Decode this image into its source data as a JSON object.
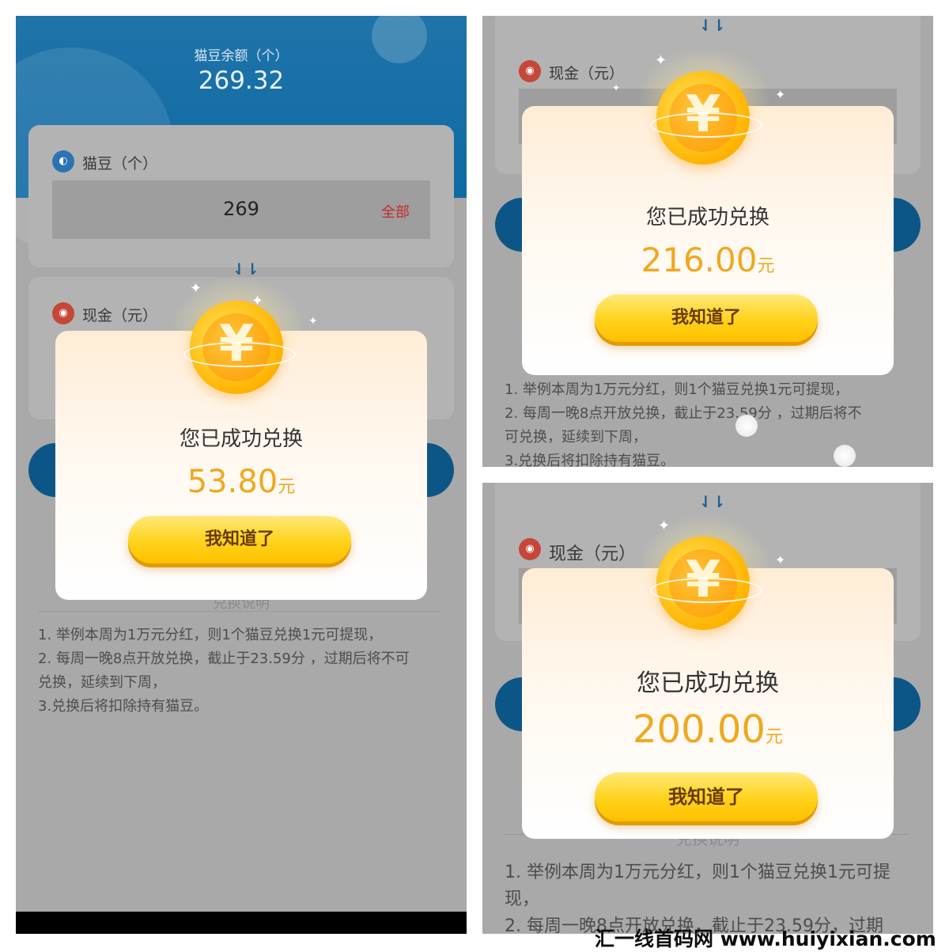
{
  "panel1": {
    "balance_label": "猫豆余额（个）",
    "balance_value": "269.32",
    "beans_label": "猫豆（个）",
    "beans_icon": "bean-icon",
    "input_value": "269",
    "all_button": "全部",
    "swap_arrow": "⇃⇂",
    "cash_label": "现金（元）",
    "cash_icon": "money-bag-icon",
    "dialog": {
      "title": "您已成功兑换",
      "amount": "53.80",
      "unit": "元",
      "button": "我知道了",
      "coin_symbol": "¥"
    },
    "rules_title": "兑换说明",
    "rules": [
      "1. 举例本周为1万元分红，则1个猫豆兑换1元可提现，",
      "2. 每周一晚8点开放兑换，截止于23.59分 ，过期后将不可",
      "兑换，延续到下周，",
      "3.兑换后将扣除持有猫豆。"
    ]
  },
  "panel2": {
    "swap_arrow": "⇃⇂",
    "cash_label": "现金（元）",
    "dialog": {
      "title": "您已成功兑换",
      "amount": "216.00",
      "unit": "元",
      "button": "我知道了",
      "coin_symbol": "¥"
    },
    "rules": [
      "1. 举例本周为1万元分红，则1个猫豆兑换1元可提现，",
      "2. 每周一晚8点开放兑换，截止于23.59分 ，过期后将不",
      "可兑换，延续到下周，",
      "3.兑换后将扣除持有猫豆。"
    ]
  },
  "panel3": {
    "swap_arrow": "⇃⇂",
    "cash_label": "现金（元）",
    "dialog": {
      "title": "您已成功兑换",
      "amount": "200.00",
      "unit": "元",
      "button": "我知道了",
      "coin_symbol": "¥"
    },
    "rules_title": "兑换说明",
    "rules": [
      "1. 举例本周为1万元分红，则1个猫豆兑换1元可提",
      "现，",
      "2. 每周一晚8点开放兑换，截止于23.59分，过期"
    ]
  },
  "watermark": "汇一线首码网 www.huiyixian.com",
  "colors": {
    "header_blue": "#1f74a9",
    "amount_gold": "#f0a81f",
    "button_yellow": "#ffd21a",
    "all_red": "#c62a2a"
  }
}
